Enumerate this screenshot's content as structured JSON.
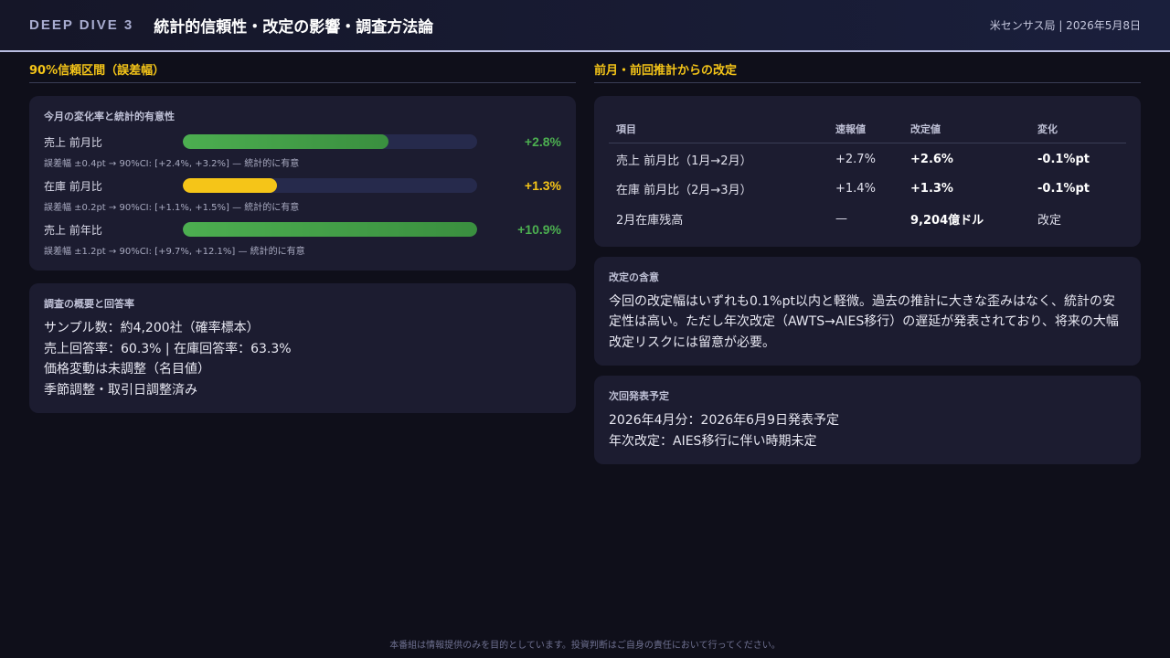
{
  "header": {
    "tag": "DEEP DIVE 3",
    "title": "統計的信頼性・改定の影響・調査方法論",
    "source": "米センサス局 | 2026年5月8日"
  },
  "left": {
    "section_title": "90%信頼区間（誤差幅）",
    "significance_card": {
      "title": "今月の変化率と統計的有意性",
      "metrics": [
        {
          "label": "売上 前月比",
          "value": "+2.8%",
          "fill": 0.7,
          "color": "green",
          "note": "誤差幅 ±0.4pt → 90%CI: [+2.4%, +3.2%] — 統計的に有意"
        },
        {
          "label": "在庫 前月比",
          "value": "+1.3%",
          "fill": 0.32,
          "color": "yellow",
          "note": "誤差幅 ±0.2pt → 90%CI: [+1.1%, +1.5%] — 統計的に有意"
        },
        {
          "label": "売上 前年比",
          "value": "+10.9%",
          "fill": 1.0,
          "color": "green",
          "note": "誤差幅 ±1.2pt → 90%CI: [+9.7%, +12.1%] — 統計的に有意"
        }
      ]
    },
    "survey_card": {
      "title": "調査の概要と回答率",
      "lines": [
        "サンプル数：約4,200社（確率標本）",
        "売上回答率：60.3% | 在庫回答率：63.3%",
        "価格変動は未調整（名目値）",
        "季節調整・取引日調整済み"
      ]
    }
  },
  "right": {
    "section_title": "前月・前回推計からの改定",
    "revision_table": {
      "headers": [
        "項目",
        "速報値",
        "改定値",
        "変化"
      ],
      "rows": [
        [
          "売上 前月比（1月→2月）",
          "+2.7%",
          "+2.6%",
          "-0.1%pt"
        ],
        [
          "在庫 前月比（2月→3月）",
          "+1.4%",
          "+1.3%",
          "-0.1%pt"
        ],
        [
          "2月在庫残高",
          "—",
          "9,204億ドル",
          "改定"
        ]
      ]
    },
    "implication_card": {
      "title": "改定の含意",
      "text": "今回の改定幅はいずれも0.1%pt以内と軽微。過去の推計に大きな歪みはなく、統計の安定性は高い。ただし年次改定（AWTS→AIES移行）の遅延が発表されており、将来の大幅改定リスクには留意が必要。"
    },
    "schedule_card": {
      "title": "次回発表予定",
      "lines": [
        "2026年4月分：2026年6月9日発表予定",
        "年次改定：AIES移行に伴い時期未定"
      ]
    }
  },
  "footer": {
    "disclaimer": "本番組は情報提供のみを目的としています。投資判断はご自身の責任において行ってください。"
  }
}
